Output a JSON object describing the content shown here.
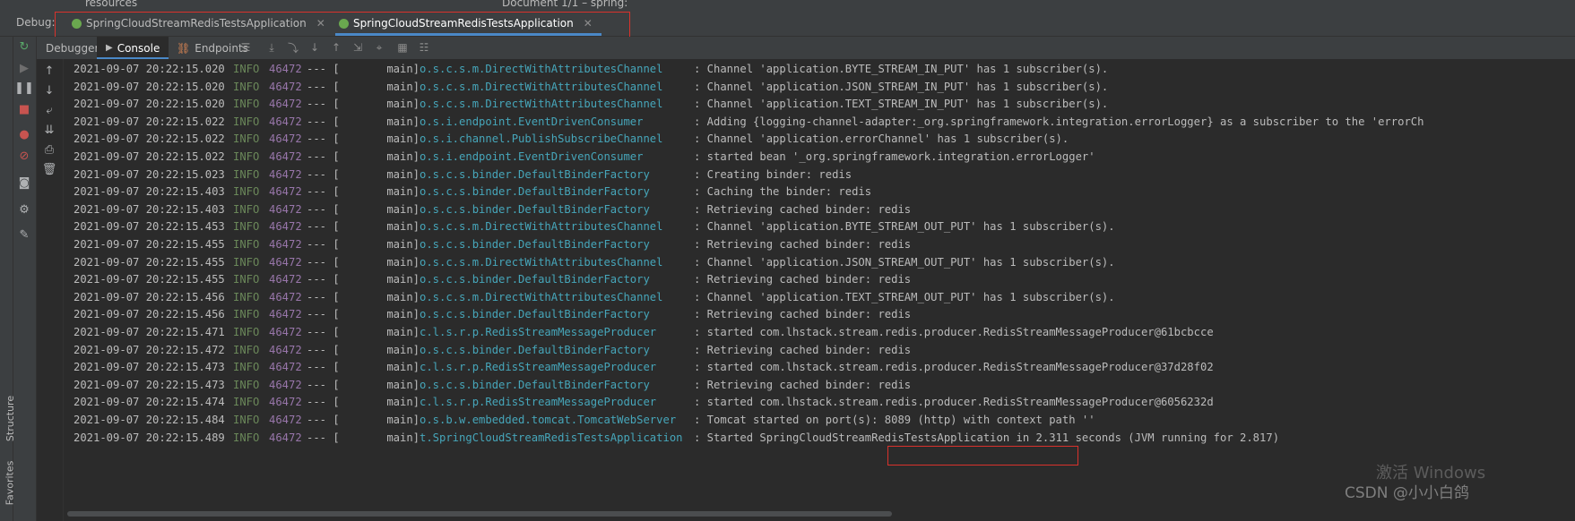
{
  "top": {
    "crumb": "resources",
    "crumb2": "Document 1/1 – spring:"
  },
  "debug_bar": {
    "label": "Debug:",
    "tabs": [
      {
        "label": "SpringCloudStreamRedisTestsApplication",
        "active": false
      },
      {
        "label": "SpringCloudStreamRedisTestsApplication",
        "active": true
      }
    ]
  },
  "subtabs": {
    "debugger": "Debugger",
    "console": "Console",
    "endpoints": "Endpoints"
  },
  "side": {
    "structure": "Structure",
    "favorites": "Favorites"
  },
  "colors": {
    "accent": "#4a88c7",
    "highlight": "#d9322c",
    "level": "#6a8759",
    "pid": "#9876aa",
    "logger": "#46a6ba"
  },
  "log": [
    {
      "ts": "2021-09-07 20:22:15.020",
      "lvl": "INFO",
      "pid": "46472",
      "sep": "--- [",
      "thr": "main]",
      "logger": "o.s.c.s.m.DirectWithAttributesChannel",
      "msg": ": Channel 'application.BYTE_STREAM_IN_PUT' has 1 subscriber(s)."
    },
    {
      "ts": "2021-09-07 20:22:15.020",
      "lvl": "INFO",
      "pid": "46472",
      "sep": "--- [",
      "thr": "main]",
      "logger": "o.s.c.s.m.DirectWithAttributesChannel",
      "msg": ": Channel 'application.JSON_STREAM_IN_PUT' has 1 subscriber(s)."
    },
    {
      "ts": "2021-09-07 20:22:15.020",
      "lvl": "INFO",
      "pid": "46472",
      "sep": "--- [",
      "thr": "main]",
      "logger": "o.s.c.s.m.DirectWithAttributesChannel",
      "msg": ": Channel 'application.TEXT_STREAM_IN_PUT' has 1 subscriber(s)."
    },
    {
      "ts": "2021-09-07 20:22:15.022",
      "lvl": "INFO",
      "pid": "46472",
      "sep": "--- [",
      "thr": "main]",
      "logger": "o.s.i.endpoint.EventDrivenConsumer",
      "msg": ": Adding {logging-channel-adapter:_org.springframework.integration.errorLogger} as a subscriber to the 'errorCh"
    },
    {
      "ts": "2021-09-07 20:22:15.022",
      "lvl": "INFO",
      "pid": "46472",
      "sep": "--- [",
      "thr": "main]",
      "logger": "o.s.i.channel.PublishSubscribeChannel",
      "msg": ": Channel 'application.errorChannel' has 1 subscriber(s)."
    },
    {
      "ts": "2021-09-07 20:22:15.022",
      "lvl": "INFO",
      "pid": "46472",
      "sep": "--- [",
      "thr": "main]",
      "logger": "o.s.i.endpoint.EventDrivenConsumer",
      "msg": ": started bean '_org.springframework.integration.errorLogger'"
    },
    {
      "ts": "2021-09-07 20:22:15.023",
      "lvl": "INFO",
      "pid": "46472",
      "sep": "--- [",
      "thr": "main]",
      "logger": "o.s.c.s.binder.DefaultBinderFactory",
      "msg": ": Creating binder: redis"
    },
    {
      "ts": "2021-09-07 20:22:15.403",
      "lvl": "INFO",
      "pid": "46472",
      "sep": "--- [",
      "thr": "main]",
      "logger": "o.s.c.s.binder.DefaultBinderFactory",
      "msg": ": Caching the binder: redis"
    },
    {
      "ts": "2021-09-07 20:22:15.403",
      "lvl": "INFO",
      "pid": "46472",
      "sep": "--- [",
      "thr": "main]",
      "logger": "o.s.c.s.binder.DefaultBinderFactory",
      "msg": ": Retrieving cached binder: redis"
    },
    {
      "ts": "2021-09-07 20:22:15.453",
      "lvl": "INFO",
      "pid": "46472",
      "sep": "--- [",
      "thr": "main]",
      "logger": "o.s.c.s.m.DirectWithAttributesChannel",
      "msg": ": Channel 'application.BYTE_STREAM_OUT_PUT' has 1 subscriber(s)."
    },
    {
      "ts": "2021-09-07 20:22:15.455",
      "lvl": "INFO",
      "pid": "46472",
      "sep": "--- [",
      "thr": "main]",
      "logger": "o.s.c.s.binder.DefaultBinderFactory",
      "msg": ": Retrieving cached binder: redis"
    },
    {
      "ts": "2021-09-07 20:22:15.455",
      "lvl": "INFO",
      "pid": "46472",
      "sep": "--- [",
      "thr": "main]",
      "logger": "o.s.c.s.m.DirectWithAttributesChannel",
      "msg": ": Channel 'application.JSON_STREAM_OUT_PUT' has 1 subscriber(s)."
    },
    {
      "ts": "2021-09-07 20:22:15.455",
      "lvl": "INFO",
      "pid": "46472",
      "sep": "--- [",
      "thr": "main]",
      "logger": "o.s.c.s.binder.DefaultBinderFactory",
      "msg": ": Retrieving cached binder: redis"
    },
    {
      "ts": "2021-09-07 20:22:15.456",
      "lvl": "INFO",
      "pid": "46472",
      "sep": "--- [",
      "thr": "main]",
      "logger": "o.s.c.s.m.DirectWithAttributesChannel",
      "msg": ": Channel 'application.TEXT_STREAM_OUT_PUT' has 1 subscriber(s)."
    },
    {
      "ts": "2021-09-07 20:22:15.456",
      "lvl": "INFO",
      "pid": "46472",
      "sep": "--- [",
      "thr": "main]",
      "logger": "o.s.c.s.binder.DefaultBinderFactory",
      "msg": ": Retrieving cached binder: redis"
    },
    {
      "ts": "2021-09-07 20:22:15.471",
      "lvl": "INFO",
      "pid": "46472",
      "sep": "--- [",
      "thr": "main]",
      "logger": "c.l.s.r.p.RedisStreamMessageProducer",
      "msg": ": started com.lhstack.stream.redis.producer.RedisStreamMessageProducer@61bcbcce"
    },
    {
      "ts": "2021-09-07 20:22:15.472",
      "lvl": "INFO",
      "pid": "46472",
      "sep": "--- [",
      "thr": "main]",
      "logger": "o.s.c.s.binder.DefaultBinderFactory",
      "msg": ": Retrieving cached binder: redis"
    },
    {
      "ts": "2021-09-07 20:22:15.473",
      "lvl": "INFO",
      "pid": "46472",
      "sep": "--- [",
      "thr": "main]",
      "logger": "c.l.s.r.p.RedisStreamMessageProducer",
      "msg": ": started com.lhstack.stream.redis.producer.RedisStreamMessageProducer@37d28f02"
    },
    {
      "ts": "2021-09-07 20:22:15.473",
      "lvl": "INFO",
      "pid": "46472",
      "sep": "--- [",
      "thr": "main]",
      "logger": "o.s.c.s.binder.DefaultBinderFactory",
      "msg": ": Retrieving cached binder: redis"
    },
    {
      "ts": "2021-09-07 20:22:15.474",
      "lvl": "INFO",
      "pid": "46472",
      "sep": "--- [",
      "thr": "main]",
      "logger": "c.l.s.r.p.RedisStreamMessageProducer",
      "msg": ": started com.lhstack.stream.redis.producer.RedisStreamMessageProducer@6056232d"
    },
    {
      "ts": "2021-09-07 20:22:15.484",
      "lvl": "INFO",
      "pid": "46472",
      "sep": "--- [",
      "thr": "main]",
      "logger": "o.s.b.w.embedded.tomcat.TomcatWebServer",
      "msg": ": Tomcat started on port(s): 8089 (http) with context path ''"
    },
    {
      "ts": "2021-09-07 20:22:15.489",
      "lvl": "INFO",
      "pid": "46472",
      "sep": "--- [",
      "thr": "main]",
      "logger": "t.SpringCloudStreamRedisTestsApplication",
      "msg": ": Started SpringCloudStreamRedisTestsApplication in 2.311 seconds (JVM running for 2.817)"
    }
  ],
  "overlay": {
    "activate": "激活 Windows",
    "watermark": "CSDN @小小白鸽"
  }
}
